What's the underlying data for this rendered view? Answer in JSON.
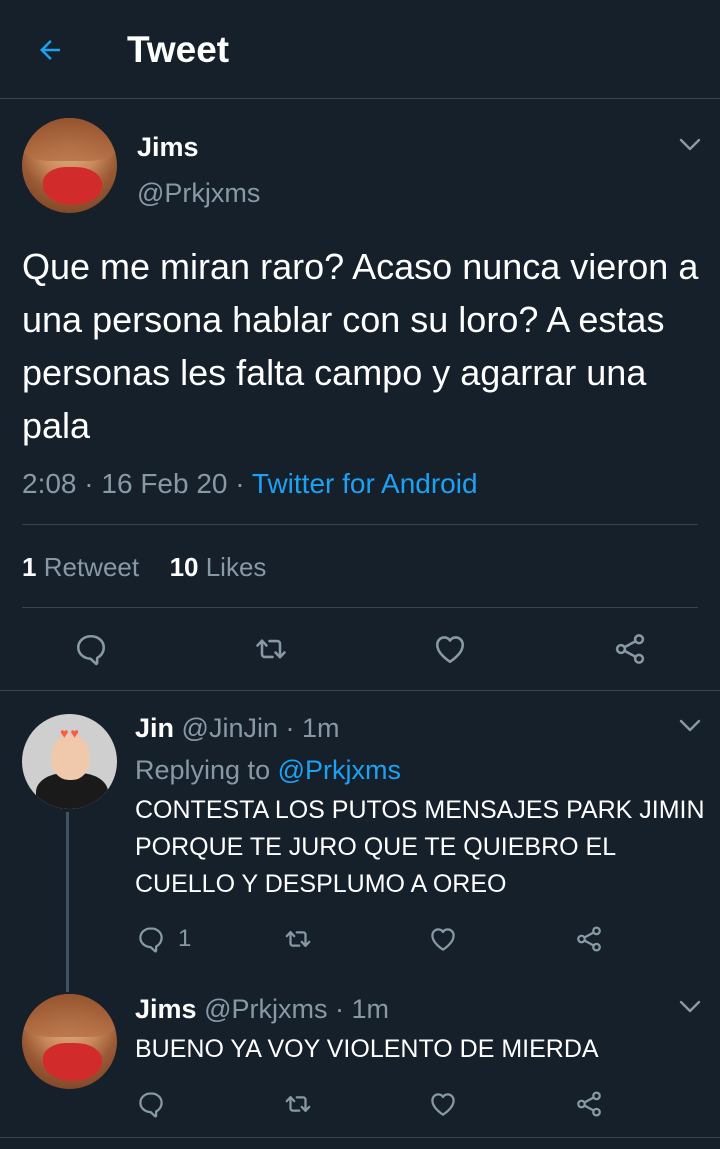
{
  "header": {
    "title": "Tweet",
    "back_icon": "back-arrow-icon"
  },
  "colors": {
    "background": "#15202b",
    "accent": "#1da1f2",
    "muted": "#8899a6",
    "divider": "#38444d"
  },
  "tweet": {
    "author_name": "Jims",
    "author_handle": "@Prkjxms",
    "text": "Que me miran raro? Acaso nunca vieron a una persona hablar con su loro? A estas personas les falta campo y agarrar una pala",
    "time": "2:08",
    "date": "16 Feb 20",
    "source": "Twitter for Android",
    "retweet_count": "1",
    "retweet_label": "Retweet",
    "like_count": "10",
    "like_label": "Likes"
  },
  "replies": [
    {
      "author_name": "Jin",
      "author_handle": "@JinJin",
      "time": "1m",
      "replying_prefix": "Replying to",
      "replying_to": "@Prkjxms",
      "text": "CONTESTA LOS PUTOS MENSAJES PARK JIMIN PORQUE TE JURO QUE TE QUIEBRO EL CUELLO Y DESPLUMO A OREO",
      "reply_count": "1"
    },
    {
      "author_name": "Jims",
      "author_handle": "@Prkjxms",
      "time": "1m",
      "text": "BUENO YA VOY VIOLENTO DE MIERDA",
      "reply_count": ""
    }
  ],
  "separator": "·"
}
